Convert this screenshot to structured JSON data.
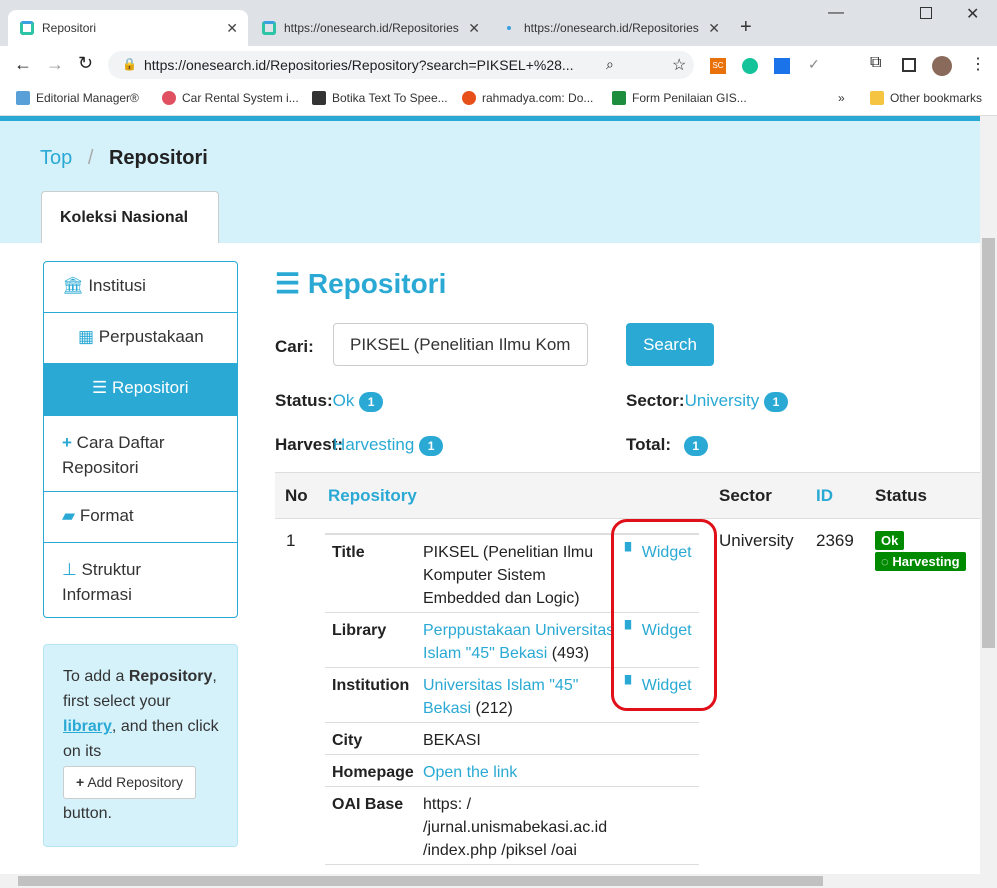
{
  "browser": {
    "tabs": [
      {
        "title": "Repositori",
        "active": true
      },
      {
        "title": "https://onesearch.id/Repositories",
        "active": false
      },
      {
        "title": "https://onesearch.id/Repositories",
        "active": false
      }
    ],
    "url": "https://onesearch.id/Repositories/Repository?search=PIKSEL+%28...",
    "bookmarks": [
      "Editorial Manager®",
      "Car Rental System i...",
      "Botika Text To Spee...",
      "rahmadya.com: Do...",
      "Form Penilaian GIS..."
    ],
    "other_bookmarks": "Other bookmarks",
    "more_bookmarks": "»"
  },
  "breadcrumb": {
    "top": "Top",
    "sep": "/",
    "current": "Repositori"
  },
  "collection_tab": "Koleksi Nasional",
  "sidebar": {
    "items": [
      {
        "label": "Institusi",
        "icon": "institution-icon"
      },
      {
        "label": "Perpustakaan",
        "icon": "building-icon"
      },
      {
        "label": "Repositori",
        "icon": "database-icon"
      },
      {
        "label": "Cara Daftar Repositori",
        "icon": "plus-icon"
      },
      {
        "label": "Format",
        "icon": "book-icon"
      },
      {
        "label": "Struktur Informasi",
        "icon": "sitemap-icon"
      }
    ],
    "help": {
      "p1": "To add a",
      "strong": "Repository",
      "p2": ", first select your",
      "link": "library",
      "p3": ", and then click on its",
      "button": "Add Repository",
      "p4": "button."
    }
  },
  "main": {
    "heading": "Repositori",
    "search_label": "Cari:",
    "search_value": "PIKSEL (Penelitian Ilmu Kom",
    "search_button": "Search",
    "status_label": "Status:",
    "status_value": "Ok",
    "status_count": "1",
    "sector_label": "Sector:",
    "sector_value": "University",
    "sector_count": "1",
    "harvest_label": "Harvest:",
    "harvest_value": "Harvesting",
    "harvest_count": "1",
    "total_label": "Total:",
    "total_count": "1",
    "columns": [
      "No",
      "Repository",
      "Sector",
      "ID",
      "Status"
    ],
    "row": {
      "no": "1",
      "sector": "University",
      "id": "2369",
      "status_ok": "Ok",
      "status_harvest": "Harvesting",
      "details": [
        {
          "label": "Title",
          "value": "PIKSEL (Penelitian Ilmu Komputer Sistem Embedded dan Logic)",
          "widget": "Widget"
        },
        {
          "label": "Library",
          "value": "Perppustakaan Universitas Islam \"45\" Bekasi",
          "count": "(493)",
          "widget": "Widget"
        },
        {
          "label": "Institution",
          "value": "Universitas Islam \"45\" Bekasi",
          "count": "(212)",
          "widget": "Widget"
        },
        {
          "label": "City",
          "value": "BEKASI"
        },
        {
          "label": "Homepage",
          "value": "Open the link"
        },
        {
          "label": "OAI Base",
          "value": "https: / /jurnal.unismabekasi.ac.id /index.php /piksel /oai"
        }
      ]
    }
  },
  "colors": {
    "accent": "#29a9d4",
    "hero": "#d5f2fb",
    "ok": "#008a00",
    "highlight": "#e0101a"
  }
}
